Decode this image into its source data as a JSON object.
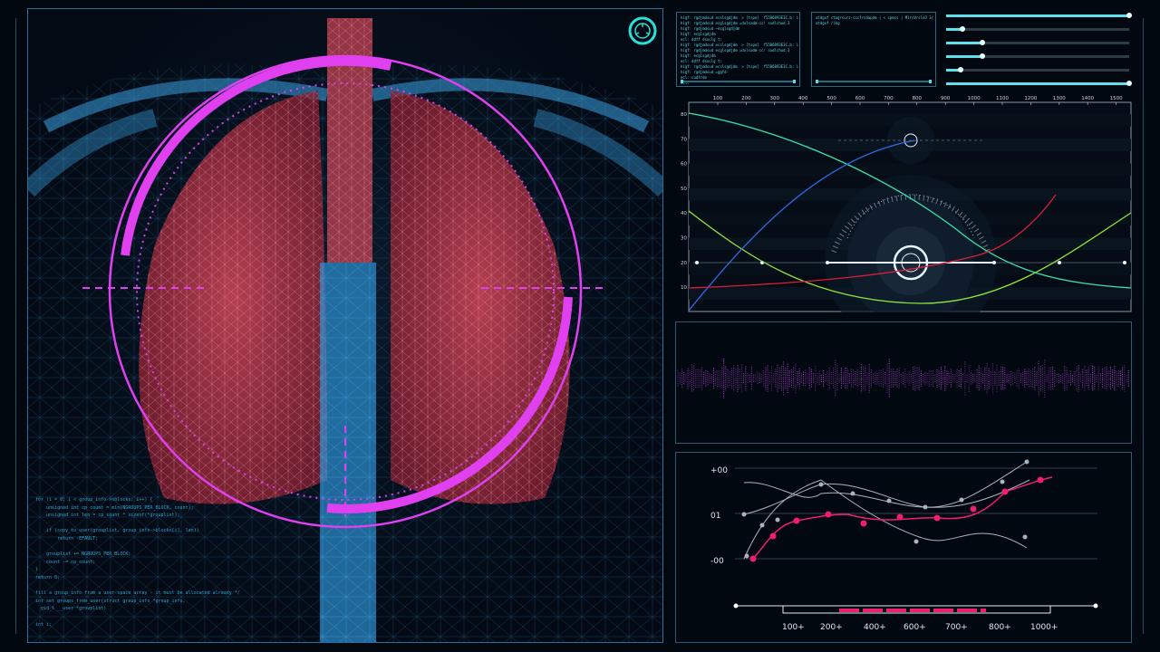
{
  "colors": {
    "accent": "#29e0d8",
    "magenta": "#e040f0",
    "lung_red": "#c23a4c",
    "wire_blue": "#3aa0e0",
    "panel_border": "#2d6f9a",
    "series_green": "#8ee63c",
    "series_teal": "#3ee0a8",
    "series_blue": "#2f6ce8",
    "series_red": "#d82038",
    "series_pink": "#f01e6c"
  },
  "scan": {
    "corner_icon": "radar-target-icon",
    "code_lines": [
      "for (i = 0; i < group_info->nblocks; i++) {",
      "    unsigned int cp_count = min(NGROUPS_PER_BLOCK, count);",
      "    unsigned int len = cp_count * sizeof(*grouplist);",
      "",
      "    if (copy_to_user(grouplist, group_info->blocks[i], len))",
      "        return -EFAULT;",
      "",
      "    grouplist += NGROUPS_PER_BLOCK;",
      "    count -= cp_count;",
      "}",
      "return 0;",
      "",
      "fill a group_info from a user-space array - it must be allocated already */",
      "int set groups_from_user(struct group_info *group_info,",
      "  gid_t __user *grouplist)",
      "",
      "int i;"
    ]
  },
  "terminals": [
    {
      "lines": [
        "higf: rgdjmdsud ecslsgdjdm  > [tspo]  f5586893E3C.b: i:",
        "higf: rgdjmdsud ecglsgdjdm =dxlsadm-cc! sudlchud.3",
        "higf: rgdjmdsud ~ecglsgdjdm",
        "higf: ecglsgdjdm",
        "ecl: ddff dsuclg t:",
        "",
        "higf: rgdjmdsud ecslsgdjdm  > [tspo]  f5586893E3C.b: i:",
        "higf: rgdjmdsud ecglsgdjdm =dxlsadm-cc! sudlchud.3",
        "higf: ecglsgdjdm",
        "ecl: ddff dsuclg t:",
        "",
        "higf: rgdjmdsud ecslsgdjdm  > [tspo]  f5586893E3C.b: i:",
        "higf: rgdjmdsud =ggfd-",
        "ecl: cudfrde",
        "ecl:"
      ]
    },
    {
      "lines": [
        "atdgxf ctagrcurz-cccfrcdapdm | < cpmcs | MlrsVrslsO 3/ 3)",
        "atdgxf rlkg"
      ]
    }
  ],
  "sliders": [
    {
      "value": 1.0
    },
    {
      "value": 0.09
    },
    {
      "value": 0.2
    },
    {
      "value": 0.2
    },
    {
      "value": 0.08
    },
    {
      "value": 1.0
    }
  ],
  "main_graph": {
    "x_ticks": [
      "100",
      "200",
      "300",
      "400",
      "500",
      "600",
      "700",
      "800",
      "900",
      "1000",
      "1100",
      "1200",
      "1300",
      "1400",
      "1500"
    ],
    "y_ticks": [
      "80",
      "70",
      "60",
      "50",
      "40",
      "30",
      "20",
      "10"
    ]
  },
  "lower_graph": {
    "y_labels": [
      "+00",
      "01",
      "-00"
    ],
    "x_labels": [
      "100+",
      "200+",
      "400+",
      "600+",
      "700+",
      "800+",
      "1000+"
    ]
  }
}
